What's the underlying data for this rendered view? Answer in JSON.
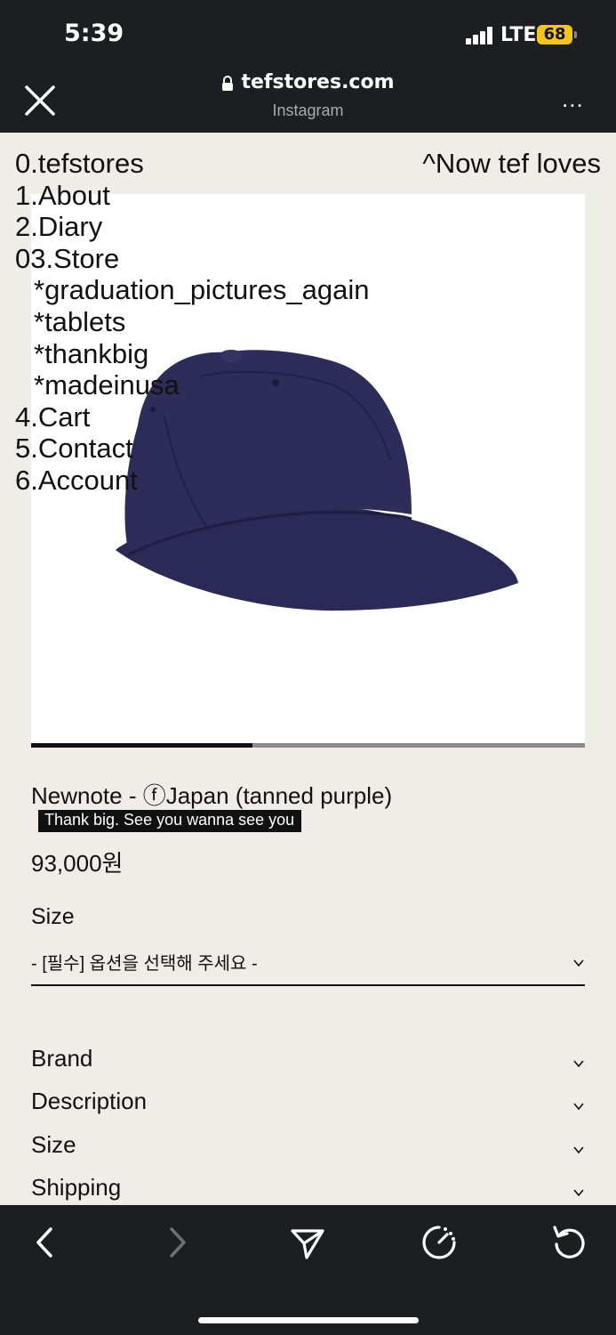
{
  "status_bar": {
    "time": "5:39",
    "network": "LTE",
    "battery": "68"
  },
  "browser": {
    "url": "tefstores.com",
    "source": "Instagram",
    "more_label": "..."
  },
  "nav_menu": {
    "items": [
      "0.tefstores",
      "1.About",
      "2.Diary",
      "03.Store"
    ],
    "store_subitems": [
      "*graduation_pictures_again",
      "*tablets",
      "*thankbig",
      "*madeinusa"
    ],
    "more_items": [
      "4.Cart",
      "5.Contact",
      "6.Account"
    ],
    "right_link": "^Now tef loves"
  },
  "product": {
    "title": "Newnote - ⓕJapan (tanned purple)",
    "tagline": "Thank big. See you wanna see you",
    "price": "93,000원",
    "image_progress": 0.4,
    "image_icon": "purple-baseball-cap"
  },
  "size_option": {
    "label": "Size",
    "selected": "- [필수] 옵션을 선택해 주세요 -"
  },
  "accordions": [
    "Brand",
    "Description",
    "Size",
    "Shipping"
  ],
  "colors": {
    "browser_chrome": "#1c1e21",
    "page_bg": "#eeede8",
    "cap": "#2e2c58",
    "battery": "#f5c518"
  },
  "toolbar_icons": [
    "back-icon",
    "forward-icon",
    "share-icon",
    "speed-icon",
    "reload-icon"
  ]
}
